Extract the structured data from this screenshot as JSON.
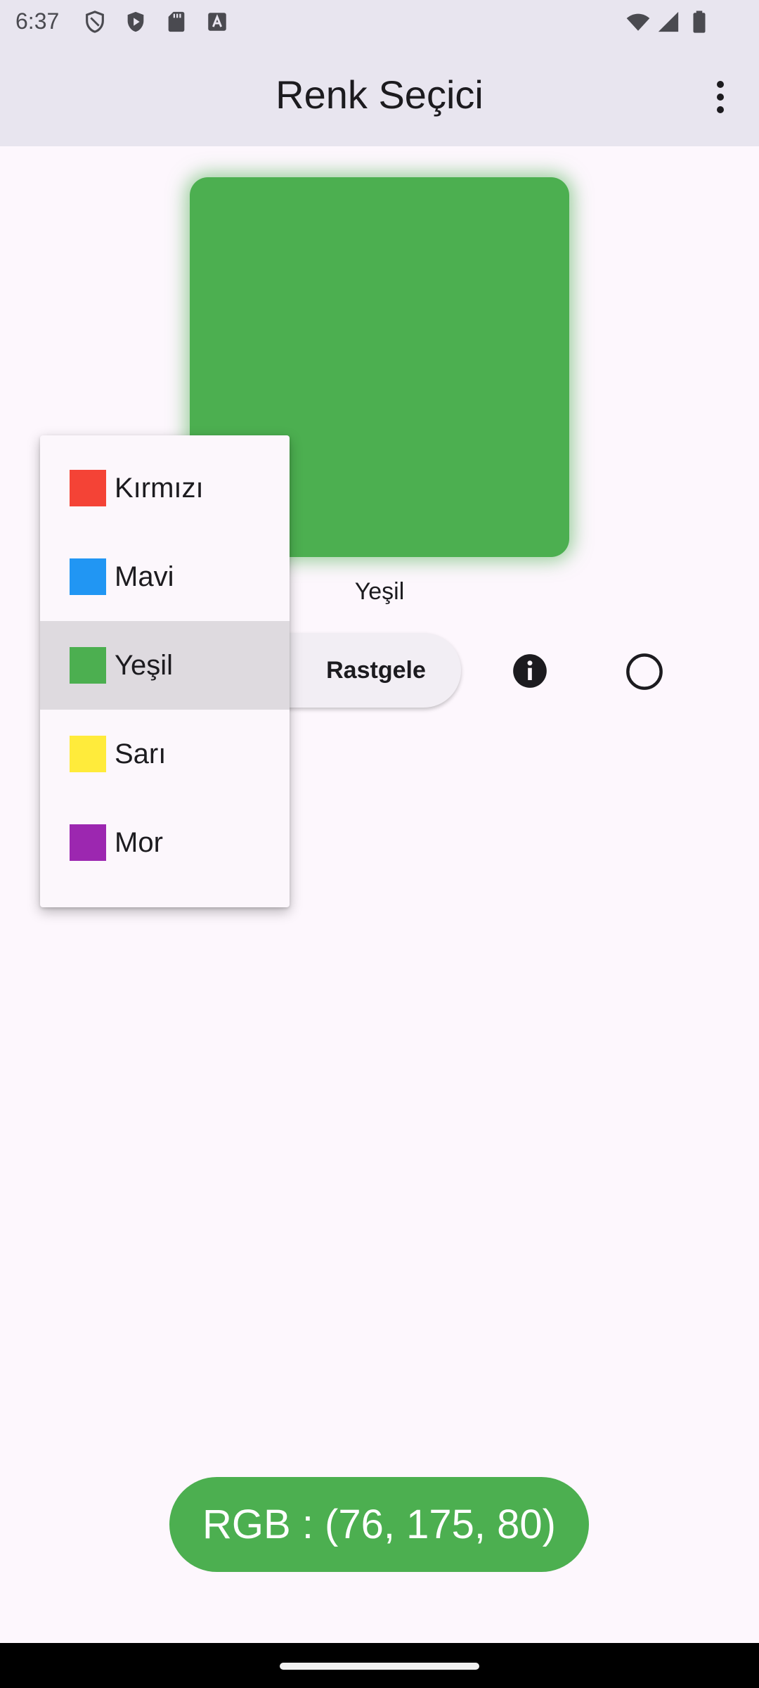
{
  "status_bar": {
    "time": "6:37",
    "left_icons": [
      "shield-outline-icon",
      "shield-play-icon",
      "sd-card-icon",
      "keyboard-a-icon"
    ],
    "right_icons": [
      "wifi-icon",
      "signal-icon",
      "battery-icon"
    ]
  },
  "app_bar": {
    "title": "Renk Seçici",
    "menu_icon": "more-vertical-icon"
  },
  "preview": {
    "color": "#4caf50",
    "name": "Yeşil"
  },
  "actions": {
    "random_label": "Rastgele",
    "info_icon": "info-icon",
    "circle_icon": "circle-outline-icon"
  },
  "dropdown": {
    "items": [
      {
        "label": "Kırmızı",
        "color": "#f44336",
        "selected": false
      },
      {
        "label": "Mavi",
        "color": "#2196f3",
        "selected": false
      },
      {
        "label": "Yeşil",
        "color": "#4caf50",
        "selected": true
      },
      {
        "label": "Sarı",
        "color": "#ffeb3b",
        "selected": false
      },
      {
        "label": "Mor",
        "color": "#9c27b0",
        "selected": false
      }
    ]
  },
  "rgb": {
    "text": "RGB : (76, 175, 80)"
  }
}
